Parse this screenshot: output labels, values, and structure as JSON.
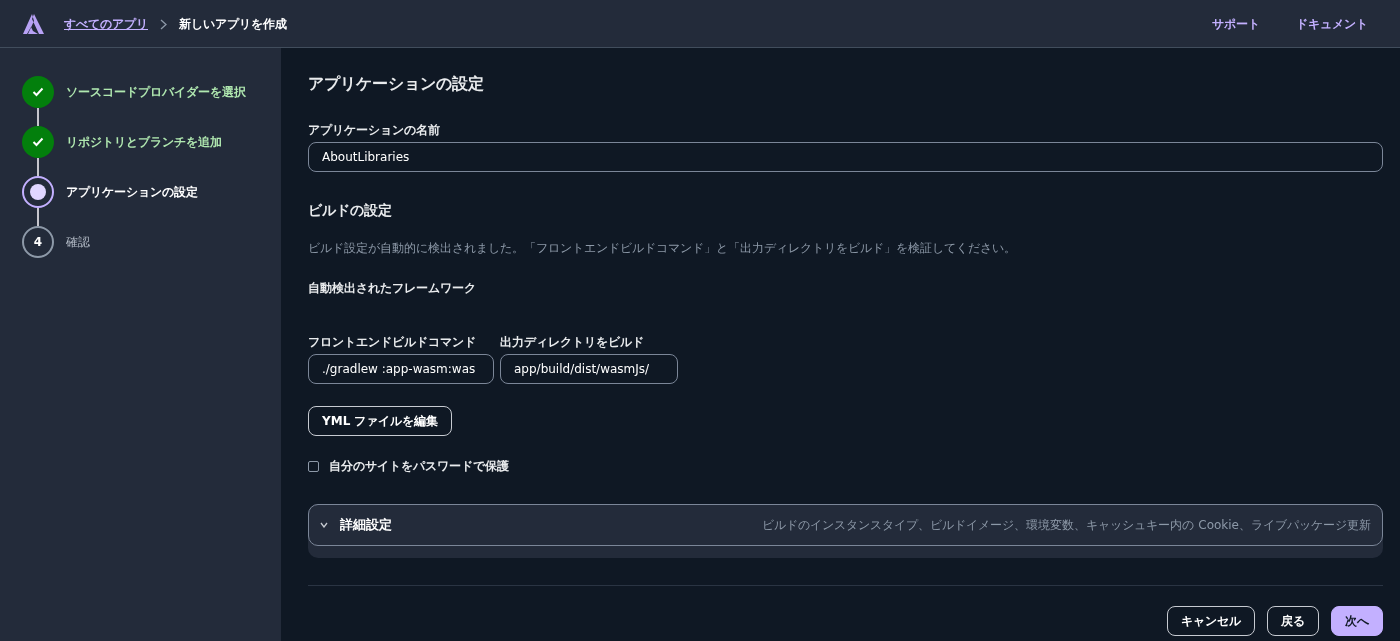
{
  "header": {
    "breadcrumbs": [
      {
        "label": "すべてのアプリ",
        "kind": "link"
      },
      {
        "label": "新しいアプリを作成",
        "kind": "current"
      }
    ],
    "links": [
      "サポート",
      "ドキュメント"
    ]
  },
  "steps": [
    {
      "label": "ソースコードプロバイダーを選択",
      "kind": "done"
    },
    {
      "label": "リポジトリとブランチを追加",
      "kind": "done"
    },
    {
      "label": "アプリケーションの設定",
      "kind": "current"
    },
    {
      "label": "確認",
      "kind": "pending",
      "number": "4"
    }
  ],
  "main": {
    "title": "アプリケーションの設定",
    "name_field": {
      "label": "アプリケーションの名前",
      "value": "AboutLibraries"
    },
    "build": {
      "title": "ビルドの設定",
      "description": "ビルド設定が自動的に検出されました。「フロントエンドビルドコマンド」と「出力ディレクトリをビルド」を検証してください。",
      "framework_label": "自動検出されたフレームワーク",
      "fields": [
        {
          "label": "フロントエンドビルドコマンド",
          "value": "./gradlew :app-wasm:was"
        },
        {
          "label": "出力ディレクトリをビルド",
          "value": "app/build/dist/wasmJs/"
        }
      ],
      "edit_button": "YML ファイルを編集",
      "password_checkbox": {
        "label": "自分のサイトをパスワードで保護",
        "checked": false
      }
    },
    "advanced": {
      "title": "詳細設定",
      "description": "ビルドのインスタンスタイプ、ビルドイメージ、環境変数、キャッシュキー内の Cookie、ライブパッケージ更新",
      "expanded": false
    },
    "buttons": [
      {
        "label": "キャンセル",
        "kind": "secondary"
      },
      {
        "label": "戻る",
        "kind": "secondary"
      },
      {
        "label": "次へ",
        "kind": "primary"
      }
    ]
  }
}
